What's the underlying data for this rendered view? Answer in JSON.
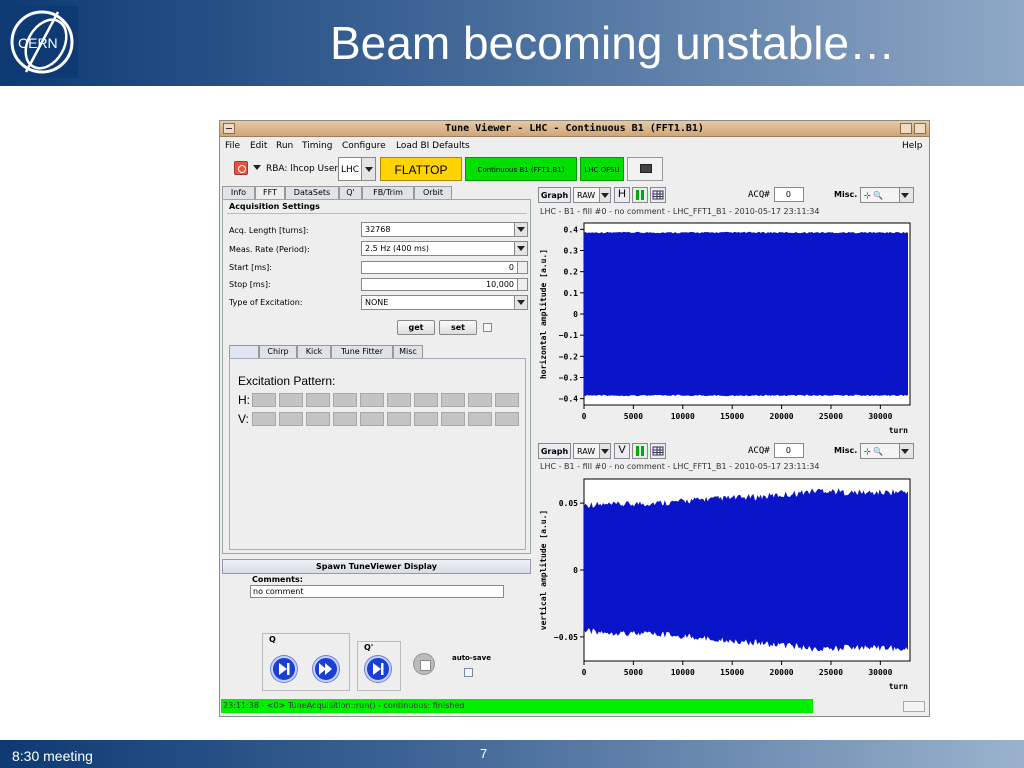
{
  "slide": {
    "title": "Beam becoming unstable…",
    "footer_left": "8:30 meeting",
    "page_number": "7",
    "logo_text": "CERN",
    "header_color": "#0d3a73"
  },
  "window": {
    "title": "Tune Viewer - LHC - Continuous B1 (FFT1.B1)"
  },
  "menu": {
    "items": [
      "File",
      "Edit",
      "Run",
      "Timing",
      "Configure",
      "Load BI Defaults"
    ],
    "help": "Help"
  },
  "toolbar": {
    "rba_label": "RBA: lhcop User:",
    "user_value": "LHC",
    "mode": "FLATTOP",
    "mode_color": "#ffd200",
    "acquisition": "Continuous B1 (FFT1.B1)",
    "ofsu": "LHC.OFSU",
    "status_color": "#00e000"
  },
  "tabs": [
    "Info",
    "FFT",
    "DataSets",
    "Q'",
    "FB/Trim",
    "Orbit"
  ],
  "acquisition": {
    "group_title": "Acquisition Settings",
    "length_label": "Acq. Length [turns]:",
    "length_value": "32768",
    "rate_label": "Meas. Rate (Period):",
    "rate_value": "2.5 Hz (400 ms)",
    "start_label": "Start [ms]:",
    "start_value": "0",
    "stop_label": "Stop [ms]:",
    "stop_value": "10,000",
    "excitation_label": "Type of Excitation:",
    "excitation_value": "NONE",
    "get_label": "get",
    "set_label": "set"
  },
  "subtabs": [
    "",
    "Chirp",
    "Kick",
    "Tune Fitter",
    "Misc"
  ],
  "excitation": {
    "title": "Excitation Pattern:",
    "h_label": "H:",
    "v_label": "V:"
  },
  "spawn_label": "Spawn TuneViewer Display",
  "comments": {
    "label": "Comments:",
    "value": "no comment"
  },
  "controls": {
    "q_label": "Q",
    "qprime_label": "Q'",
    "autosave_label": "auto-save"
  },
  "status_text": "23:11:38 - <0> TuneAcquisition::run() - continuous: finished",
  "graphs": [
    {
      "graph_label": "Graph",
      "mode": "RAW",
      "plane": "H",
      "acq_label": "ACQ#",
      "acq_value": "0",
      "misc_label": "Misc.",
      "info": "LHC - B1 - fill #0 - no comment - LHC_FFT1_B1 - 2010-05-17 23:11:34"
    },
    {
      "graph_label": "Graph",
      "mode": "RAW",
      "plane": "V",
      "acq_label": "ACQ#",
      "acq_value": "0",
      "misc_label": "Misc.",
      "info": "LHC - B1 - fill #0 - no comment - LHC_FFT1_B1 - 2010-05-17 23:11:34"
    }
  ],
  "chart_data": [
    {
      "type": "area",
      "title": "",
      "xlabel": "turn",
      "ylabel": "horizontal amplitude [a.u.]",
      "xlim": [
        0,
        33000
      ],
      "ylim": [
        -0.43,
        0.43
      ],
      "xticks": [
        0,
        5000,
        10000,
        15000,
        20000,
        25000,
        30000
      ],
      "xtick_labels": [
        "0",
        "5000",
        "10000",
        "15000",
        "20000",
        "25000",
        "30000"
      ],
      "yticks": [
        0.4,
        0.3,
        0.2,
        0.1,
        0,
        -0.1,
        -0.2,
        -0.3,
        -0.4
      ],
      "ytick_labels": [
        "0.4",
        "0.3",
        "0.2",
        "0.1",
        "0",
        "-0.1",
        "-0.2",
        "-0.3",
        "-0.4"
      ],
      "envelope_x": [
        0,
        3000,
        6000,
        9000,
        12000,
        15000,
        18000,
        21000,
        24000,
        27000,
        30000,
        32768
      ],
      "envelope_upper": [
        0.38,
        0.38,
        0.38,
        0.38,
        0.38,
        0.38,
        0.38,
        0.38,
        0.38,
        0.38,
        0.38,
        0.38
      ],
      "envelope_lower": [
        -0.38,
        -0.38,
        -0.38,
        -0.38,
        -0.38,
        -0.38,
        -0.38,
        -0.38,
        -0.38,
        -0.38,
        -0.38,
        -0.38
      ],
      "color": "#0a14c8",
      "grid": false
    },
    {
      "type": "area",
      "title": "",
      "xlabel": "turn",
      "ylabel": "vertical amplitude [a.u.]",
      "xlim": [
        0,
        33000
      ],
      "ylim": [
        -0.068,
        0.068
      ],
      "xticks": [
        0,
        5000,
        10000,
        15000,
        20000,
        25000,
        30000
      ],
      "xtick_labels": [
        "0",
        "5000",
        "10000",
        "15000",
        "20000",
        "25000",
        "30000"
      ],
      "yticks": [
        0.05,
        0,
        -0.05
      ],
      "ytick_labels": [
        "0.05",
        "0",
        "-0.05"
      ],
      "envelope_x": [
        0,
        3000,
        6000,
        9000,
        12000,
        15000,
        18000,
        21000,
        24000,
        27000,
        30000,
        32768
      ],
      "envelope_upper": [
        0.046,
        0.046,
        0.047,
        0.048,
        0.05,
        0.051,
        0.052,
        0.054,
        0.057,
        0.055,
        0.055,
        0.056
      ],
      "envelope_lower": [
        -0.043,
        -0.044,
        -0.045,
        -0.046,
        -0.048,
        -0.05,
        -0.052,
        -0.054,
        -0.057,
        -0.055,
        -0.055,
        -0.057
      ],
      "color": "#0a14c8",
      "grid": false
    }
  ]
}
